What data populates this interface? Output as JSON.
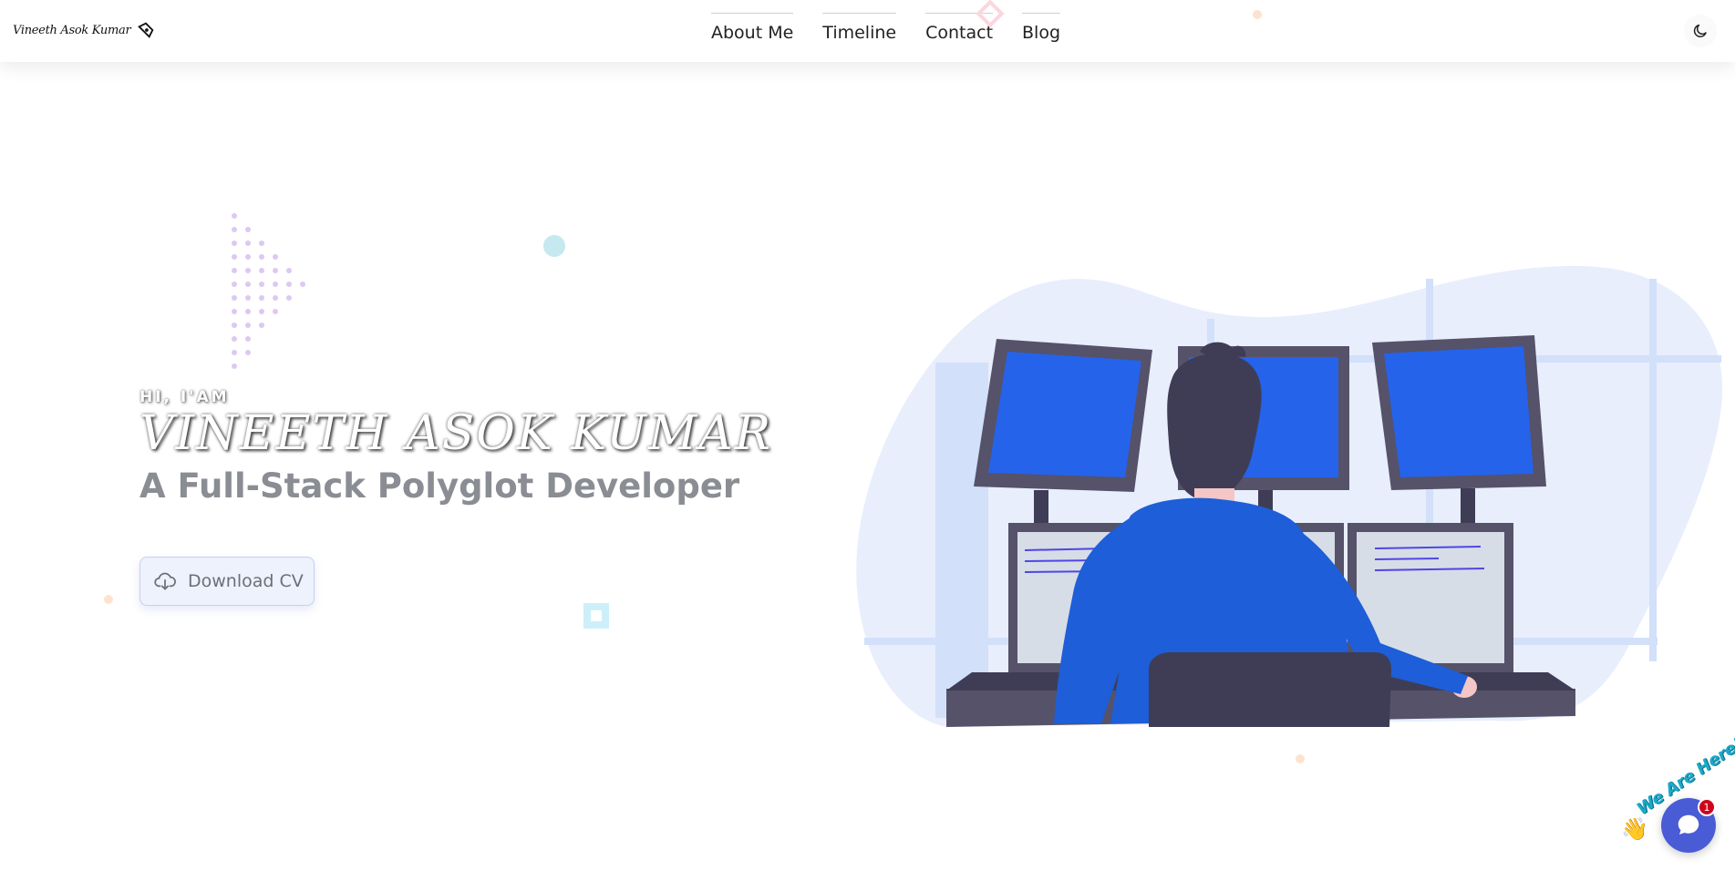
{
  "header": {
    "logo_text": "Vineeth Asok Kumar",
    "nav": [
      {
        "label": "About Me"
      },
      {
        "label": "Timeline"
      },
      {
        "label": "Contact"
      },
      {
        "label": "Blog"
      }
    ],
    "theme_toggle_icon": "moon-icon"
  },
  "hero": {
    "greeting": "HI, I'AM",
    "name": "VINEETH ASOK KUMAR",
    "role": "A Full-Stack Polyglot Developer",
    "cv_button_label": "Download CV",
    "cv_button_icon": "cloud-download-icon",
    "illustration": "developer-at-multiple-monitors"
  },
  "chat": {
    "label": "We Are Here!",
    "badge_count": "1",
    "icon": "chat-bubble-icon"
  },
  "colors": {
    "accent_blue": "#2563eb",
    "role_gray": "#8a8d93",
    "button_bg": "#eef2fd",
    "chat_button": "#4a5bd6"
  }
}
